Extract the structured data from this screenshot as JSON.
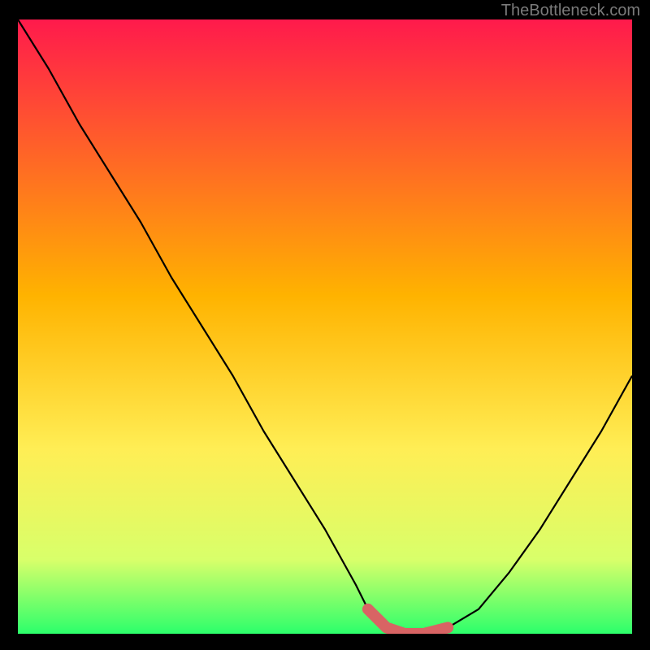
{
  "watermark": "TheBottleneck.com",
  "colors": {
    "bg": "#000000",
    "curve": "#000000",
    "marker": "#d86464",
    "gradient_top": "#ff1a4c",
    "gradient_mid1": "#ffb300",
    "gradient_mid2": "#ffee55",
    "gradient_mid3": "#d8ff6a",
    "gradient_bottom": "#2cff6b"
  },
  "chart_data": {
    "type": "line",
    "title": "",
    "xlabel": "",
    "ylabel": "",
    "xlim": [
      0,
      100
    ],
    "ylim": [
      0,
      100
    ],
    "series": [
      {
        "name": "bottleneck-curve",
        "x": [
          0,
          5,
          10,
          15,
          20,
          25,
          30,
          35,
          40,
          45,
          50,
          55,
          57,
          60,
          63,
          66,
          70,
          75,
          80,
          85,
          90,
          95,
          100
        ],
        "y": [
          100,
          92,
          83,
          75,
          67,
          58,
          50,
          42,
          33,
          25,
          17,
          8,
          4,
          1,
          0,
          0,
          1,
          4,
          10,
          17,
          25,
          33,
          42
        ]
      },
      {
        "name": "optimal-range",
        "x": [
          57,
          60,
          63,
          66,
          70
        ],
        "y": [
          4,
          1,
          0,
          0,
          1
        ]
      }
    ],
    "gradient_stops": [
      {
        "offset": 0.0,
        "color": "#ff1a4c"
      },
      {
        "offset": 0.45,
        "color": "#ffb300"
      },
      {
        "offset": 0.7,
        "color": "#ffee55"
      },
      {
        "offset": 0.88,
        "color": "#d8ff6a"
      },
      {
        "offset": 1.0,
        "color": "#2cff6b"
      }
    ]
  }
}
